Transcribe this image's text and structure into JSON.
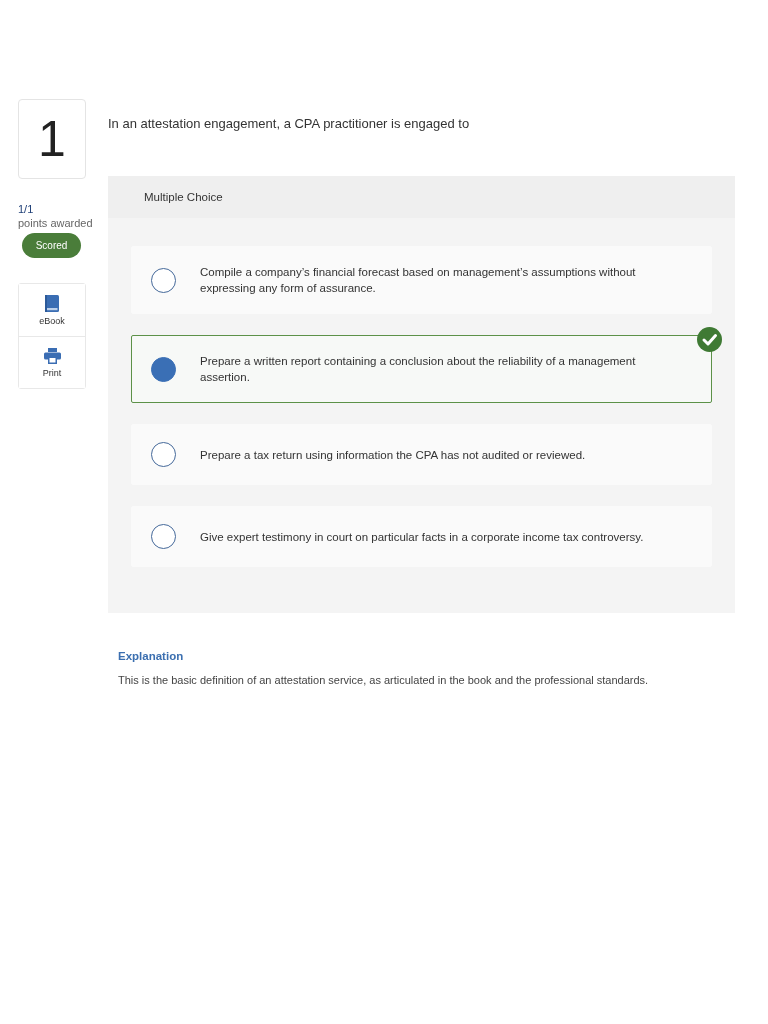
{
  "question": {
    "number": "1",
    "points": "1/1",
    "points_label": "points awarded",
    "status": "Scored",
    "text": "In an attestation engagement, a CPA practitioner is engaged to"
  },
  "tools": [
    {
      "kind": "ebook",
      "label": "eBook"
    },
    {
      "kind": "print",
      "label": "Print"
    }
  ],
  "answer_panel": {
    "type_label": "Multiple Choice",
    "options": [
      {
        "text": "Compile a company’s financial forecast based on management’s assumptions without expressing any form of assurance.",
        "selected": false,
        "correct": false
      },
      {
        "text": "Prepare a written report containing a conclusion about the reliability of a management assertion.",
        "selected": true,
        "correct": true
      },
      {
        "text": "Prepare a tax return using information the CPA has not audited or reviewed.",
        "selected": false,
        "correct": false
      },
      {
        "text": "Give expert testimony in court on particular facts in a corporate income tax controversy.",
        "selected": false,
        "correct": false
      }
    ]
  },
  "explanation": {
    "title": "Explanation",
    "text": "This is the basic definition of an attestation service, as articulated in the book and the professional standards."
  }
}
